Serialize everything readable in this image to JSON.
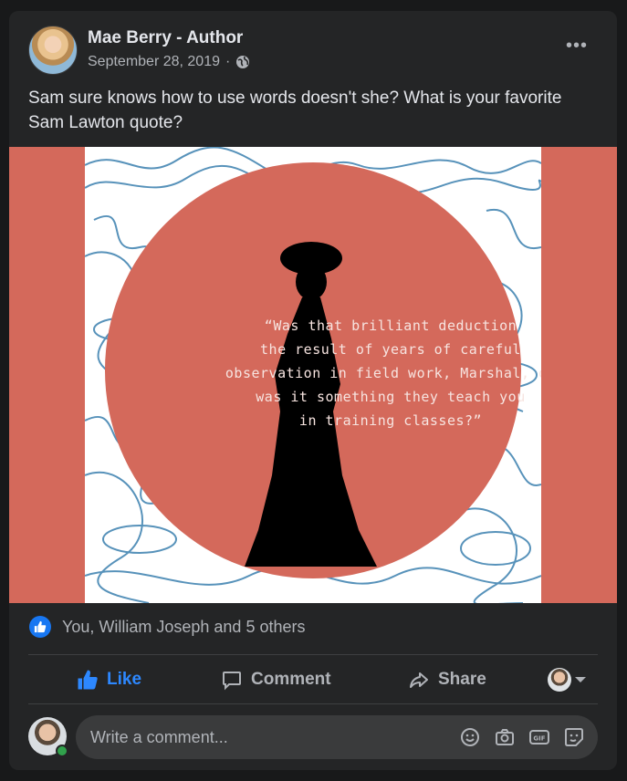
{
  "post": {
    "author": "Mae Berry - Author",
    "date": "September 28, 2019",
    "date_separator": "·",
    "text": "Sam sure knows how to use words doesn't she? What is your favorite Sam Lawton quote?",
    "more_label": "•••"
  },
  "image": {
    "quote": "“Was that brilliant deduction\nthe result of years of careful\nobservation in field work, Marshal, or\nwas it something they teach you\nin training classes?”",
    "colors": {
      "background": "#d4695b",
      "circle": "#d4695b",
      "scribble": "#3a7fae",
      "silhouette": "#000000"
    }
  },
  "reactions": {
    "summary": "You, William Joseph and 5 others"
  },
  "actions": {
    "like_label": "Like",
    "comment_label": "Comment",
    "share_label": "Share"
  },
  "composer": {
    "placeholder": "Write a comment..."
  },
  "icons": [
    "globe-icon",
    "more-options-icon",
    "like-reaction-icon",
    "like-icon",
    "comment-icon",
    "share-icon",
    "emoji-icon",
    "camera-icon",
    "gif-icon",
    "sticker-icon"
  ]
}
